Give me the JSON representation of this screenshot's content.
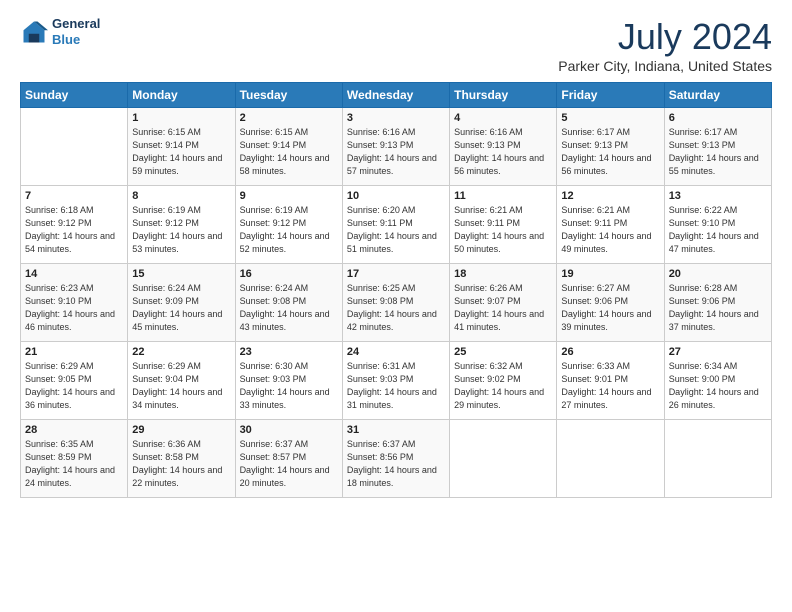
{
  "logo": {
    "line1": "General",
    "line2": "Blue"
  },
  "title": "July 2024",
  "location": "Parker City, Indiana, United States",
  "days_header": [
    "Sunday",
    "Monday",
    "Tuesday",
    "Wednesday",
    "Thursday",
    "Friday",
    "Saturday"
  ],
  "weeks": [
    [
      {
        "num": "",
        "sunrise": "",
        "sunset": "",
        "daylight": ""
      },
      {
        "num": "1",
        "sunrise": "Sunrise: 6:15 AM",
        "sunset": "Sunset: 9:14 PM",
        "daylight": "Daylight: 14 hours and 59 minutes."
      },
      {
        "num": "2",
        "sunrise": "Sunrise: 6:15 AM",
        "sunset": "Sunset: 9:14 PM",
        "daylight": "Daylight: 14 hours and 58 minutes."
      },
      {
        "num": "3",
        "sunrise": "Sunrise: 6:16 AM",
        "sunset": "Sunset: 9:13 PM",
        "daylight": "Daylight: 14 hours and 57 minutes."
      },
      {
        "num": "4",
        "sunrise": "Sunrise: 6:16 AM",
        "sunset": "Sunset: 9:13 PM",
        "daylight": "Daylight: 14 hours and 56 minutes."
      },
      {
        "num": "5",
        "sunrise": "Sunrise: 6:17 AM",
        "sunset": "Sunset: 9:13 PM",
        "daylight": "Daylight: 14 hours and 56 minutes."
      },
      {
        "num": "6",
        "sunrise": "Sunrise: 6:17 AM",
        "sunset": "Sunset: 9:13 PM",
        "daylight": "Daylight: 14 hours and 55 minutes."
      }
    ],
    [
      {
        "num": "7",
        "sunrise": "Sunrise: 6:18 AM",
        "sunset": "Sunset: 9:12 PM",
        "daylight": "Daylight: 14 hours and 54 minutes."
      },
      {
        "num": "8",
        "sunrise": "Sunrise: 6:19 AM",
        "sunset": "Sunset: 9:12 PM",
        "daylight": "Daylight: 14 hours and 53 minutes."
      },
      {
        "num": "9",
        "sunrise": "Sunrise: 6:19 AM",
        "sunset": "Sunset: 9:12 PM",
        "daylight": "Daylight: 14 hours and 52 minutes."
      },
      {
        "num": "10",
        "sunrise": "Sunrise: 6:20 AM",
        "sunset": "Sunset: 9:11 PM",
        "daylight": "Daylight: 14 hours and 51 minutes."
      },
      {
        "num": "11",
        "sunrise": "Sunrise: 6:21 AM",
        "sunset": "Sunset: 9:11 PM",
        "daylight": "Daylight: 14 hours and 50 minutes."
      },
      {
        "num": "12",
        "sunrise": "Sunrise: 6:21 AM",
        "sunset": "Sunset: 9:11 PM",
        "daylight": "Daylight: 14 hours and 49 minutes."
      },
      {
        "num": "13",
        "sunrise": "Sunrise: 6:22 AM",
        "sunset": "Sunset: 9:10 PM",
        "daylight": "Daylight: 14 hours and 47 minutes."
      }
    ],
    [
      {
        "num": "14",
        "sunrise": "Sunrise: 6:23 AM",
        "sunset": "Sunset: 9:10 PM",
        "daylight": "Daylight: 14 hours and 46 minutes."
      },
      {
        "num": "15",
        "sunrise": "Sunrise: 6:24 AM",
        "sunset": "Sunset: 9:09 PM",
        "daylight": "Daylight: 14 hours and 45 minutes."
      },
      {
        "num": "16",
        "sunrise": "Sunrise: 6:24 AM",
        "sunset": "Sunset: 9:08 PM",
        "daylight": "Daylight: 14 hours and 43 minutes."
      },
      {
        "num": "17",
        "sunrise": "Sunrise: 6:25 AM",
        "sunset": "Sunset: 9:08 PM",
        "daylight": "Daylight: 14 hours and 42 minutes."
      },
      {
        "num": "18",
        "sunrise": "Sunrise: 6:26 AM",
        "sunset": "Sunset: 9:07 PM",
        "daylight": "Daylight: 14 hours and 41 minutes."
      },
      {
        "num": "19",
        "sunrise": "Sunrise: 6:27 AM",
        "sunset": "Sunset: 9:06 PM",
        "daylight": "Daylight: 14 hours and 39 minutes."
      },
      {
        "num": "20",
        "sunrise": "Sunrise: 6:28 AM",
        "sunset": "Sunset: 9:06 PM",
        "daylight": "Daylight: 14 hours and 37 minutes."
      }
    ],
    [
      {
        "num": "21",
        "sunrise": "Sunrise: 6:29 AM",
        "sunset": "Sunset: 9:05 PM",
        "daylight": "Daylight: 14 hours and 36 minutes."
      },
      {
        "num": "22",
        "sunrise": "Sunrise: 6:29 AM",
        "sunset": "Sunset: 9:04 PM",
        "daylight": "Daylight: 14 hours and 34 minutes."
      },
      {
        "num": "23",
        "sunrise": "Sunrise: 6:30 AM",
        "sunset": "Sunset: 9:03 PM",
        "daylight": "Daylight: 14 hours and 33 minutes."
      },
      {
        "num": "24",
        "sunrise": "Sunrise: 6:31 AM",
        "sunset": "Sunset: 9:03 PM",
        "daylight": "Daylight: 14 hours and 31 minutes."
      },
      {
        "num": "25",
        "sunrise": "Sunrise: 6:32 AM",
        "sunset": "Sunset: 9:02 PM",
        "daylight": "Daylight: 14 hours and 29 minutes."
      },
      {
        "num": "26",
        "sunrise": "Sunrise: 6:33 AM",
        "sunset": "Sunset: 9:01 PM",
        "daylight": "Daylight: 14 hours and 27 minutes."
      },
      {
        "num": "27",
        "sunrise": "Sunrise: 6:34 AM",
        "sunset": "Sunset: 9:00 PM",
        "daylight": "Daylight: 14 hours and 26 minutes."
      }
    ],
    [
      {
        "num": "28",
        "sunrise": "Sunrise: 6:35 AM",
        "sunset": "Sunset: 8:59 PM",
        "daylight": "Daylight: 14 hours and 24 minutes."
      },
      {
        "num": "29",
        "sunrise": "Sunrise: 6:36 AM",
        "sunset": "Sunset: 8:58 PM",
        "daylight": "Daylight: 14 hours and 22 minutes."
      },
      {
        "num": "30",
        "sunrise": "Sunrise: 6:37 AM",
        "sunset": "Sunset: 8:57 PM",
        "daylight": "Daylight: 14 hours and 20 minutes."
      },
      {
        "num": "31",
        "sunrise": "Sunrise: 6:37 AM",
        "sunset": "Sunset: 8:56 PM",
        "daylight": "Daylight: 14 hours and 18 minutes."
      },
      {
        "num": "",
        "sunrise": "",
        "sunset": "",
        "daylight": ""
      },
      {
        "num": "",
        "sunrise": "",
        "sunset": "",
        "daylight": ""
      },
      {
        "num": "",
        "sunrise": "",
        "sunset": "",
        "daylight": ""
      }
    ]
  ]
}
